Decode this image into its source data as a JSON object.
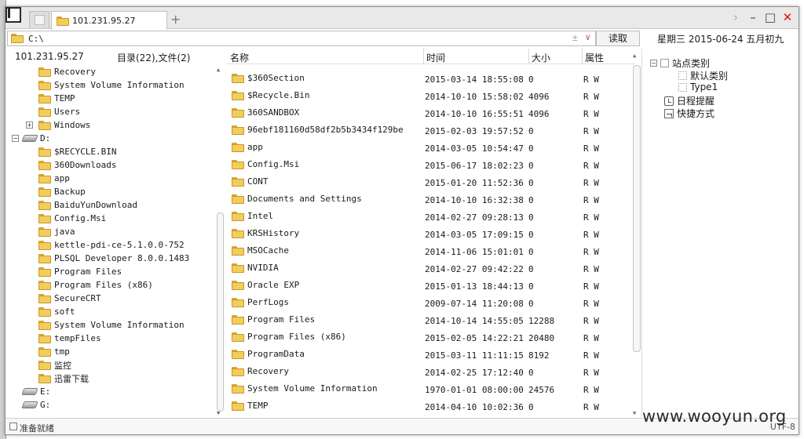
{
  "tabs": {
    "active_title": "101.231.95.27",
    "new_tab_glyph": "+"
  },
  "address": {
    "path": "C:\\",
    "read_button": "读取",
    "date_text": "星期三 2015-06-24 五月初九"
  },
  "left_pane": {
    "host": "101.231.95.27",
    "count_text": "目录(22),文件(2)",
    "tree": [
      {
        "label": "Recovery",
        "type": "folder",
        "indent": 2
      },
      {
        "label": "System Volume Information",
        "type": "folder",
        "indent": 2
      },
      {
        "label": "TEMP",
        "type": "folder",
        "indent": 2
      },
      {
        "label": "Users",
        "type": "folder",
        "indent": 2
      },
      {
        "label": "Windows",
        "type": "folder",
        "indent": 2,
        "expander": "+"
      },
      {
        "label": "D:",
        "type": "drive",
        "indent": 1,
        "expander": "−"
      },
      {
        "label": "$RECYCLE.BIN",
        "type": "folder",
        "indent": 2
      },
      {
        "label": "360Downloads",
        "type": "folder",
        "indent": 2
      },
      {
        "label": "app",
        "type": "folder",
        "indent": 2
      },
      {
        "label": "Backup",
        "type": "folder",
        "indent": 2
      },
      {
        "label": "BaiduYunDownload",
        "type": "folder",
        "indent": 2
      },
      {
        "label": "Config.Msi",
        "type": "folder",
        "indent": 2
      },
      {
        "label": "java",
        "type": "folder",
        "indent": 2
      },
      {
        "label": "kettle-pdi-ce-5.1.0.0-752",
        "type": "folder",
        "indent": 2
      },
      {
        "label": "PLSQL Developer 8.0.0.1483",
        "type": "folder",
        "indent": 2
      },
      {
        "label": "Program Files",
        "type": "folder",
        "indent": 2
      },
      {
        "label": "Program Files (x86)",
        "type": "folder",
        "indent": 2
      },
      {
        "label": "SecureCRT",
        "type": "folder",
        "indent": 2
      },
      {
        "label": "soft",
        "type": "folder",
        "indent": 2
      },
      {
        "label": "System Volume Information",
        "type": "folder",
        "indent": 2
      },
      {
        "label": "tempFiles",
        "type": "folder",
        "indent": 2
      },
      {
        "label": "tmp",
        "type": "folder",
        "indent": 2
      },
      {
        "label": "监控",
        "type": "folder",
        "indent": 2
      },
      {
        "label": "迅雷下载",
        "type": "folder",
        "indent": 2
      },
      {
        "label": "E:",
        "type": "drive",
        "indent": 1
      },
      {
        "label": "G:",
        "type": "drive",
        "indent": 1
      }
    ]
  },
  "file_list": {
    "columns": {
      "name": "名称",
      "time": "时间",
      "size": "大小",
      "attr": "属性"
    },
    "rows": [
      {
        "name": "$360Section",
        "time": "2015-03-14 18:55:08",
        "size": "0",
        "attr": "R W"
      },
      {
        "name": "$Recycle.Bin",
        "time": "2014-10-10 15:58:02",
        "size": "4096",
        "attr": "R W"
      },
      {
        "name": "360SANDBOX",
        "time": "2014-10-10 16:55:51",
        "size": "4096",
        "attr": "R W"
      },
      {
        "name": "96ebf181160d58df2b5b3434f129be",
        "time": "2015-02-03 19:57:52",
        "size": "0",
        "attr": "R W"
      },
      {
        "name": "app",
        "time": "2014-03-05 10:54:47",
        "size": "0",
        "attr": "R W"
      },
      {
        "name": "Config.Msi",
        "time": "2015-06-17 18:02:23",
        "size": "0",
        "attr": "R W"
      },
      {
        "name": "CONT",
        "time": "2015-01-20 11:52:36",
        "size": "0",
        "attr": "R W"
      },
      {
        "name": "Documents and Settings",
        "time": "2014-10-10 16:32:38",
        "size": "0",
        "attr": "R W"
      },
      {
        "name": "Intel",
        "time": "2014-02-27 09:28:13",
        "size": "0",
        "attr": "R W"
      },
      {
        "name": "KRSHistory",
        "time": "2014-03-05 17:09:15",
        "size": "0",
        "attr": "R W"
      },
      {
        "name": "MSOCache",
        "time": "2014-11-06 15:01:01",
        "size": "0",
        "attr": "R W"
      },
      {
        "name": "NVIDIA",
        "time": "2014-02-27 09:42:22",
        "size": "0",
        "attr": "R W"
      },
      {
        "name": "Oracle EXP",
        "time": "2015-01-13 18:44:13",
        "size": "0",
        "attr": "R W"
      },
      {
        "name": "PerfLogs",
        "time": "2009-07-14 11:20:08",
        "size": "0",
        "attr": "R W"
      },
      {
        "name": "Program Files",
        "time": "2014-10-14 14:55:05",
        "size": "12288",
        "attr": "R W"
      },
      {
        "name": "Program Files (x86)",
        "time": "2015-02-05 14:22:21",
        "size": "20480",
        "attr": "R W"
      },
      {
        "name": "ProgramData",
        "time": "2015-03-11 11:11:15",
        "size": "8192",
        "attr": "R W"
      },
      {
        "name": "Recovery",
        "time": "2014-02-25 17:12:40",
        "size": "0",
        "attr": "R W"
      },
      {
        "name": "System Volume Information",
        "time": "1970-01-01 08:00:00",
        "size": "24576",
        "attr": "R W"
      },
      {
        "name": "TEMP",
        "time": "2014-04-10 10:02:36",
        "size": "0",
        "attr": "R W"
      }
    ]
  },
  "right_panel": {
    "site_category": "站点类别",
    "default_category": "默认类别",
    "type1": "Type1",
    "schedule": "日程提醒",
    "shortcuts": "快捷方式"
  },
  "status": {
    "text": "准备就绪",
    "encoding": "UTF-8"
  },
  "watermark": "www.wooyun.org",
  "colors": {
    "folder": "#f2cd5c",
    "close": "#dd1111",
    "accent_dropdown": "#cc4d4d"
  }
}
